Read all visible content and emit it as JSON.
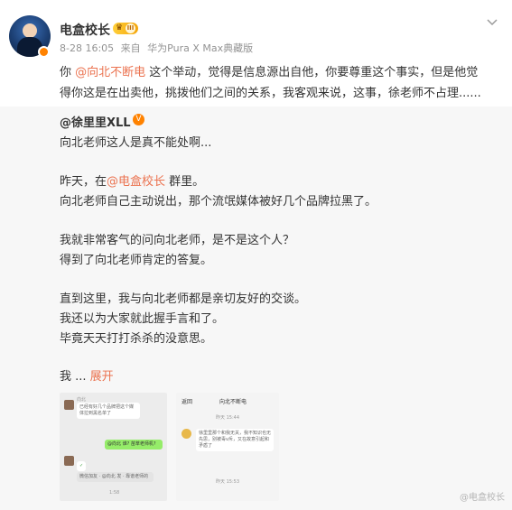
{
  "post": {
    "username": "电盒校长",
    "badge_level": "III",
    "date": "8-28 16:05",
    "source_prefix": "来自",
    "device": "华为Pura X Max典藏版",
    "text_prefix": "你 ",
    "mention": "@向北不断电",
    "text_line1_rest": " 这个举动，觉得是信息源出自他，你要尊重这个事实，但是他觉",
    "text_line2": "得你这是在出卖他，挑拨他们之间的关系，我客观来说，这事，徐老师不占理......"
  },
  "repost": {
    "author": "@徐里里XLL",
    "verified_mark": "V",
    "lines": [
      "向北老师这人是真不能处啊...",
      "昨天，在",
      "向北老师自己主动说出，那个流氓媒体被好几个品牌拉黑了。",
      "我就非常客气的问向北老师，是不是这个人？",
      "得到了向北老师肯定的答复。",
      "直到这里，我与向北老师都是亲切友好的交谈。",
      "我还以为大家就此握手言和了。",
      "毕竟天天打打杀杀的没意思。",
      "我 ... "
    ],
    "line2_mention": "@电盒校长",
    "line2_suffix": " 群里。",
    "expand_label": "展开"
  },
  "thumb1": {
    "sender": "向北",
    "message1": "已经有好几个品牌把这个媒体拉到黑名单了",
    "reply": "@向北 谁? 苗萃老师机?",
    "check": "✓",
    "footer": "微信加友 · @向北 发 · 靠谱老师的",
    "time": "1:58"
  },
  "thumb2": {
    "back": "返回",
    "title": "向北不断电",
    "time1": "昨天 15:44",
    "message": "徐里里那个和我无关，我不知识也无先思，别被毒v斥，又在故意引起和矛盾了",
    "time2": "昨天 15:53"
  },
  "watermark": "@电盒校长",
  "colors": {
    "accent": "#eb7350",
    "orange": "#ff8200",
    "text": "#333333",
    "muted": "#939393"
  }
}
